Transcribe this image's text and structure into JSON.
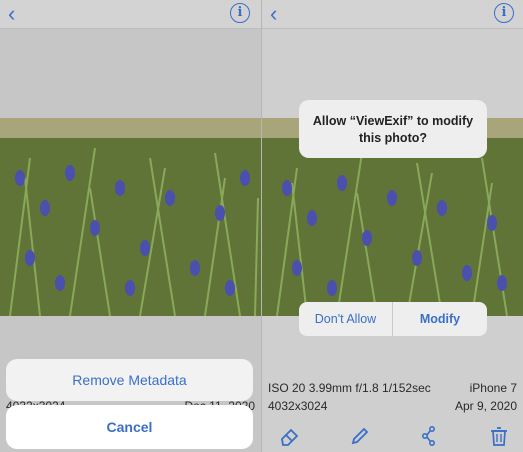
{
  "left": {
    "metadata": {
      "dimensions": "4032x3024",
      "date": "Dec 11, 2020"
    },
    "action_sheet": {
      "remove_label": "Remove Metadata",
      "cancel_label": "Cancel"
    }
  },
  "right": {
    "alert": {
      "message_line1": "Allow “ViewExif” to modify",
      "message_line2": "this photo?",
      "dont_allow_label": "Don't Allow",
      "modify_label": "Modify"
    },
    "metadata": {
      "exposure": "ISO 20  3.99mm  f/1.8  1/152sec",
      "device": "iPhone 7",
      "dimensions": "4032x3024",
      "date": "Apr 9, 2020"
    }
  },
  "icons": [
    "back-icon",
    "info-icon",
    "eraser-icon",
    "pencil-icon",
    "share-icon",
    "trash-icon"
  ],
  "colors": {
    "accent": "#3a6fc8",
    "sheet": "#f2f2f2",
    "alert": "#eeeeee"
  }
}
